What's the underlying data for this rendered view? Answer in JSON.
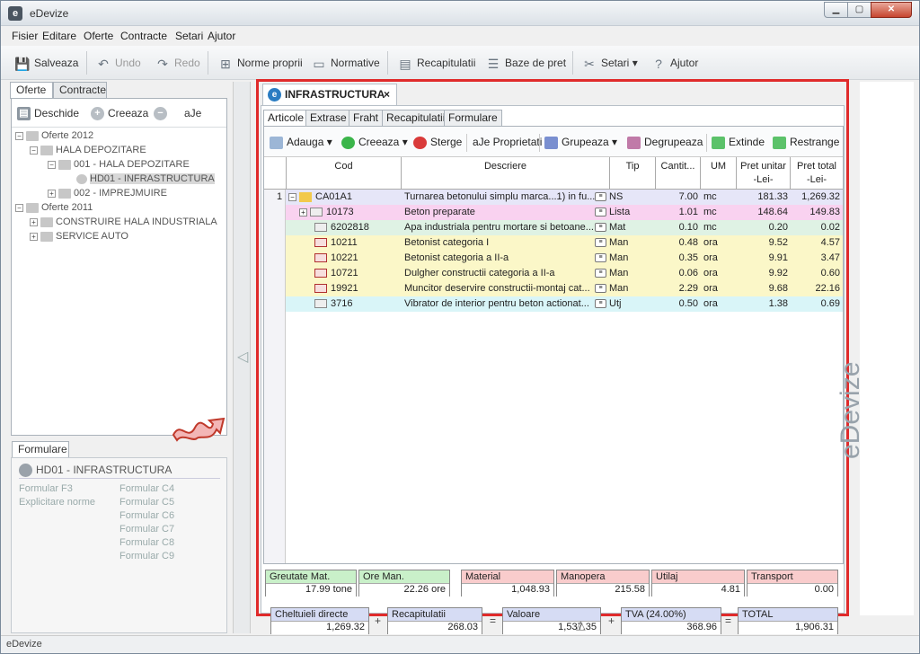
{
  "window": {
    "title": "eDevize",
    "app_icon": "e"
  },
  "menu": [
    "Fisier",
    "Editare",
    "Oferte",
    "Contracte",
    "Setari",
    "Ajutor"
  ],
  "toolbar": {
    "salveaza": "Salveaza",
    "undo": "Undo",
    "redo": "Redo",
    "norme": "Norme proprii",
    "normative": "Normative",
    "recapitulatii": "Recapitulatii",
    "baze": "Baze de pret",
    "setari": "Setari",
    "ajutor": "Ajutor"
  },
  "left": {
    "tabs": [
      "Oferte",
      "Contracte"
    ],
    "actions": {
      "deschide": "Deschide",
      "creeaza": "Creeaza",
      "rename": "aJe"
    },
    "tree": [
      {
        "label": "Oferte 2012"
      },
      {
        "label": "HALA DEPOZITARE"
      },
      {
        "label": "001 - HALA DEPOZITARE"
      },
      {
        "label": "HD01 - INFRASTRUCTURA"
      },
      {
        "label": "002 - IMPREJMUIRE"
      },
      {
        "label": "Oferte 2011"
      },
      {
        "label": "CONSTRUIRE HALA INDUSTRIALA"
      },
      {
        "label": "SERVICE AUTO"
      }
    ]
  },
  "formulare": {
    "tab": "Formulare",
    "doc": "HD01 - INFRASTRUCTURA",
    "col1": [
      "Formular F3",
      "Explicitare norme"
    ],
    "col2": [
      "Formular C4",
      "Formular C5",
      "Formular C6",
      "Formular C7",
      "Formular C8",
      "Formular C9"
    ]
  },
  "document": {
    "tab_title": "INFRASTRUCTURA",
    "close": "×",
    "subtabs": [
      "Articole",
      "Extrase",
      "Fraht",
      "Recapitulatii",
      "Formulare"
    ],
    "grid_toolbar": {
      "adauga": "Adauga",
      "creeaza": "Creeaza",
      "sterge": "Sterge",
      "proprietati": "aJe Proprietati",
      "grupeaza": "Grupeaza",
      "degrupeaza": "Degrupeaza",
      "extinde": "Extinde",
      "restrange": "Restrange"
    },
    "columns": {
      "cod": "Cod",
      "descriere": "Descriere",
      "tip": "Tip",
      "cantitate": "Cantit...",
      "um": "UM",
      "pu1": "Pret unitar",
      "pu2": "-Lei-",
      "pt1": "Pret total",
      "pt2": "-Lei-"
    },
    "rows": [
      {
        "nr": "1",
        "cod": "CA01A1",
        "descriere": "Turnarea betonului simplu marca...1) in fu...",
        "tip": "NS",
        "cant": "7.00",
        "um": "mc",
        "pu": "181.33",
        "pt": "1,269.32",
        "color": "#e6e6f8"
      },
      {
        "nr": "",
        "cod": "10173",
        "descriere": "Beton preparate",
        "tip": "Lista",
        "cant": "1.01",
        "um": "mc",
        "pu": "148.64",
        "pt": "149.83",
        "color": "#f9d2f0"
      },
      {
        "nr": "",
        "cod": "6202818",
        "descriere": "Apa industriala pentru mortare si betoane...",
        "tip": "Mat",
        "cant": "0.10",
        "um": "mc",
        "pu": "0.20",
        "pt": "0.02",
        "color": "#dff2e4"
      },
      {
        "nr": "",
        "cod": "10211",
        "descriere": "Betonist categoria I",
        "tip": "Man",
        "cant": "0.48",
        "um": "ora",
        "pu": "9.52",
        "pt": "4.57",
        "color": "#fbf7c8"
      },
      {
        "nr": "",
        "cod": "10221",
        "descriere": "Betonist categoria a II-a",
        "tip": "Man",
        "cant": "0.35",
        "um": "ora",
        "pu": "9.91",
        "pt": "3.47",
        "color": "#fbf7c8"
      },
      {
        "nr": "",
        "cod": "10721",
        "descriere": "Dulgher constructii categoria a II-a",
        "tip": "Man",
        "cant": "0.06",
        "um": "ora",
        "pu": "9.92",
        "pt": "0.60",
        "color": "#fbf7c8"
      },
      {
        "nr": "",
        "cod": "19921",
        "descriere": "Muncitor deservire constructii-montaj cat...",
        "tip": "Man",
        "cant": "2.29",
        "um": "ora",
        "pu": "9.68",
        "pt": "22.16",
        "color": "#fbf7c8"
      },
      {
        "nr": "",
        "cod": "3716",
        "descriere": "Vibrator de interior pentru beton actionat...",
        "tip": "Utj",
        "cant": "0.50",
        "um": "ora",
        "pu": "1.38",
        "pt": "0.69",
        "color": "#d9f5f8"
      }
    ],
    "totals": [
      {
        "label": "Greutate Mat.",
        "value": "17.99 tone",
        "color": "#c9f0c9"
      },
      {
        "label": "Ore Man.",
        "value": "22.26 ore",
        "color": "#c9f0c9"
      },
      {
        "label": "Material",
        "value": "1,048.93",
        "color": "#f9cccc"
      },
      {
        "label": "Manopera",
        "value": "215.58",
        "color": "#f9cccc"
      },
      {
        "label": "Utilaj",
        "value": "4.81",
        "color": "#f9cccc"
      },
      {
        "label": "Transport",
        "value": "0.00",
        "color": "#f9cccc"
      }
    ],
    "summary": [
      {
        "label": "Cheltuieli directe",
        "value": "1,269.32"
      },
      {
        "label": "Recapitulatii",
        "value": "268.03"
      },
      {
        "label": "Valoare",
        "value": "1,537.35"
      },
      {
        "label": "TVA (24.00%)",
        "value": "368.96"
      },
      {
        "label": "TOTAL",
        "value": "1,906.31"
      }
    ],
    "ops": [
      "+",
      "=",
      "+",
      "="
    ]
  },
  "logo": "eDevize",
  "status": "eDevize"
}
